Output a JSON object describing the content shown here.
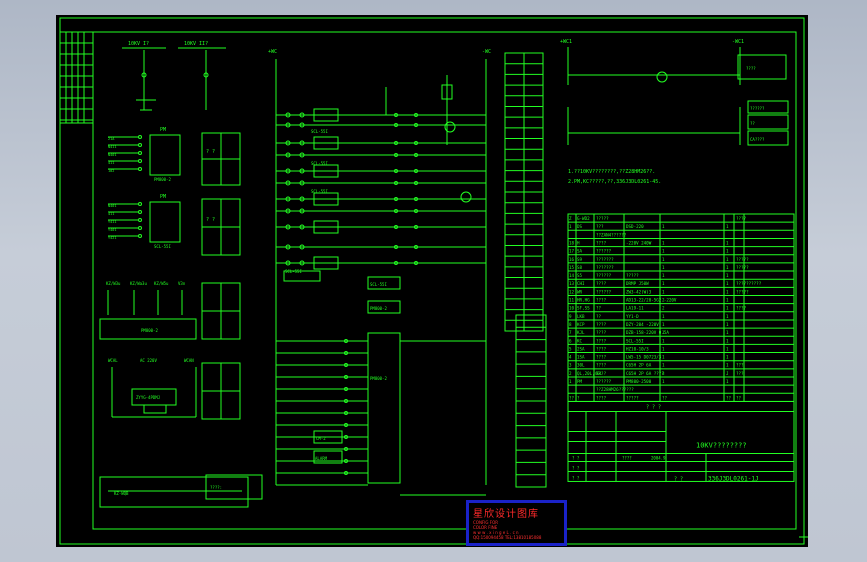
{
  "labels": {
    "left_top": [
      "10KV I?",
      "10KV II?"
    ],
    "left_mid_terms": [
      "21A",
      "N411",
      "N401",
      "411",
      "102",
      "N401",
      "411",
      "Y411",
      "Y401",
      "Y421"
    ],
    "pm_label": "PM",
    "pm_box1": "PM800-2",
    "pm_box2": "SCL-55I",
    "meter": [
      "KZ/W3u",
      "KZ/Wa3u",
      "KZ/W5u",
      "V3n"
    ],
    "meter_box": "PM800-2",
    "acdc": [
      "WCAL",
      "AC 220V",
      "WCAN"
    ],
    "acdc_box": "ZYYG-4PDMJ",
    "bottom_left": "KZ-WQB",
    "small_q": "? ?",
    "small_q2": "????:",
    "bus_top": [
      "+WC",
      "-WC"
    ],
    "right_bus_top": [
      "+WC1",
      "-WC1"
    ],
    "note1": "1.??10KV????????,??Z28HM26??.",
    "note2": "2.PM,KC?????,??,336J3DL0261-45.",
    "relay_boxes": [
      "SCL-55I",
      "SCL-55I",
      "SCL-55I",
      "SCL-55I"
    ],
    "ctrl_boxes": [
      "SCL-55I",
      "PM800-2",
      "PM800-2",
      "CM-2",
      "ALARM"
    ],
    "right_small": [
      "????",
      "??????",
      "??",
      "CA????"
    ],
    "stamp_title": "星欣设计图库",
    "stamp_line1": "CONFIG FOR",
    "stamp_line2": "COLOR FINE",
    "stamp_line3": "w w w . x i n g e  L . c n",
    "stamp_line4": "QQ:150094458 TEL:13810185088"
  },
  "bom": {
    "rows": [
      [
        "Z",
        "G-WD2",
        "?????",
        "",
        "",
        "",
        "????"
      ],
      [
        "1",
        "DS",
        "???",
        "DSD-220",
        "1",
        "1",
        ""
      ],
      [
        "",
        "",
        "??ZAN4??????",
        "",
        "",
        "",
        ""
      ],
      [
        "18",
        "H",
        "????",
        "-220V 240W",
        "1",
        "1",
        ""
      ],
      [
        "17",
        "SA",
        "??????",
        "",
        "1",
        "1",
        ""
      ],
      [
        "16",
        "S9",
        "???????",
        "",
        "1",
        "1",
        "?????"
      ],
      [
        "15",
        "S8",
        "???????",
        "",
        "1",
        "1",
        "?????"
      ],
      [
        "14",
        "S5",
        "??????",
        "?????",
        "1",
        "1",
        ""
      ],
      [
        "13",
        "CHI",
        "????",
        "DRMP J50W",
        "1",
        "1",
        "??????????"
      ],
      [
        "12",
        "WR",
        "??????",
        "ZW3-42(W)3",
        "1",
        "1",
        "?????"
      ],
      [
        "11",
        "HR,HG",
        "????",
        "AD13-22/20-5G2 -220V",
        "2",
        "1",
        ""
      ],
      [
        "10",
        "SF,SS",
        "??",
        "LA19-11",
        "2",
        "1",
        "????"
      ],
      [
        "9",
        "LKB",
        "??",
        "YY1-D",
        "1",
        "1",
        ""
      ],
      [
        "8",
        "KCP",
        "????",
        "DZY-204 -220V",
        "1",
        "1",
        ""
      ],
      [
        "7",
        "KJL",
        "????",
        "DZB-158-220V 0.5A",
        "1",
        "1",
        ""
      ],
      [
        "6",
        "KC",
        "????",
        "SCL-55I",
        "1",
        "1",
        ""
      ],
      [
        "5",
        "2SA",
        "????",
        "HZ10-10/3",
        "1",
        "1",
        ""
      ],
      [
        "4",
        "1SA",
        "????",
        "LW5-15 D0723/3",
        "1",
        "1",
        ""
      ],
      [
        "3",
        "30L",
        "????",
        "C65H 2P 6A",
        "1",
        "1",
        "???"
      ],
      [
        "2",
        "QL,20L,40L",
        "????",
        "C65H 2P 6A ????",
        "3",
        "J",
        "???"
      ],
      [
        "1",
        "PM",
        "??????",
        "PM800-2500",
        "1",
        "1",
        ""
      ],
      [
        "",
        "",
        "??Z28HM26??????",
        "",
        "",
        "",
        ""
      ],
      [
        "??",
        "?",
        "????",
        "?????",
        "??",
        "??",
        "??"
      ]
    ]
  },
  "title_block": {
    "header": "? ? ?",
    "title": "10KV????????",
    "date_label": "????",
    "date": "2004.9",
    "code_prefix": "? ?",
    "code": "336J3DL0261-1J",
    "scale": "1:1",
    "row_marks": [
      "? ?",
      "? ?",
      "? ?"
    ]
  },
  "colors": {
    "line": "#22ff22",
    "sheet": "#000000",
    "stamp_border": "#1a22c8",
    "stamp_text": "#ff2a2a"
  }
}
